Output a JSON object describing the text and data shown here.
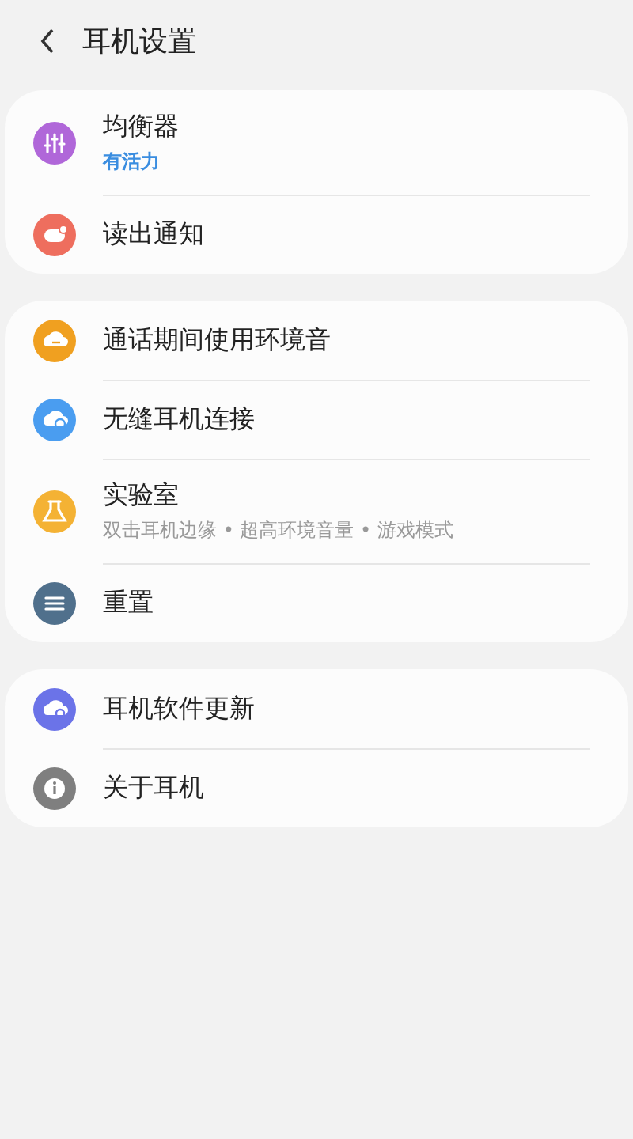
{
  "header": {
    "title": "耳机设置"
  },
  "groups": [
    {
      "items": [
        {
          "title": "均衡器",
          "subtitle": "有活力",
          "subtitle_highlighted": true,
          "kind": "equalizer",
          "color": "#b067d9"
        },
        {
          "title": "读出通知",
          "kind": "notification",
          "color": "#ee6e5e"
        }
      ]
    },
    {
      "items": [
        {
          "title": "通话期间使用环境音",
          "kind": "ambient",
          "color": "#f0a020"
        },
        {
          "title": "无缝耳机连接",
          "kind": "connect",
          "color": "#4a9df0"
        },
        {
          "title": "实验室",
          "subtitle": "双击耳机边缘 • 超高环境音量 • 游戏模式",
          "subtitle_highlighted": false,
          "kind": "lab",
          "color": "#f4b234"
        },
        {
          "title": "重置",
          "kind": "reset",
          "color": "#50708c"
        }
      ]
    },
    {
      "items": [
        {
          "title": "耳机软件更新",
          "kind": "update",
          "color": "#6b73e8"
        },
        {
          "title": "关于耳机",
          "kind": "info",
          "color": "#7f7f7f"
        }
      ]
    }
  ]
}
